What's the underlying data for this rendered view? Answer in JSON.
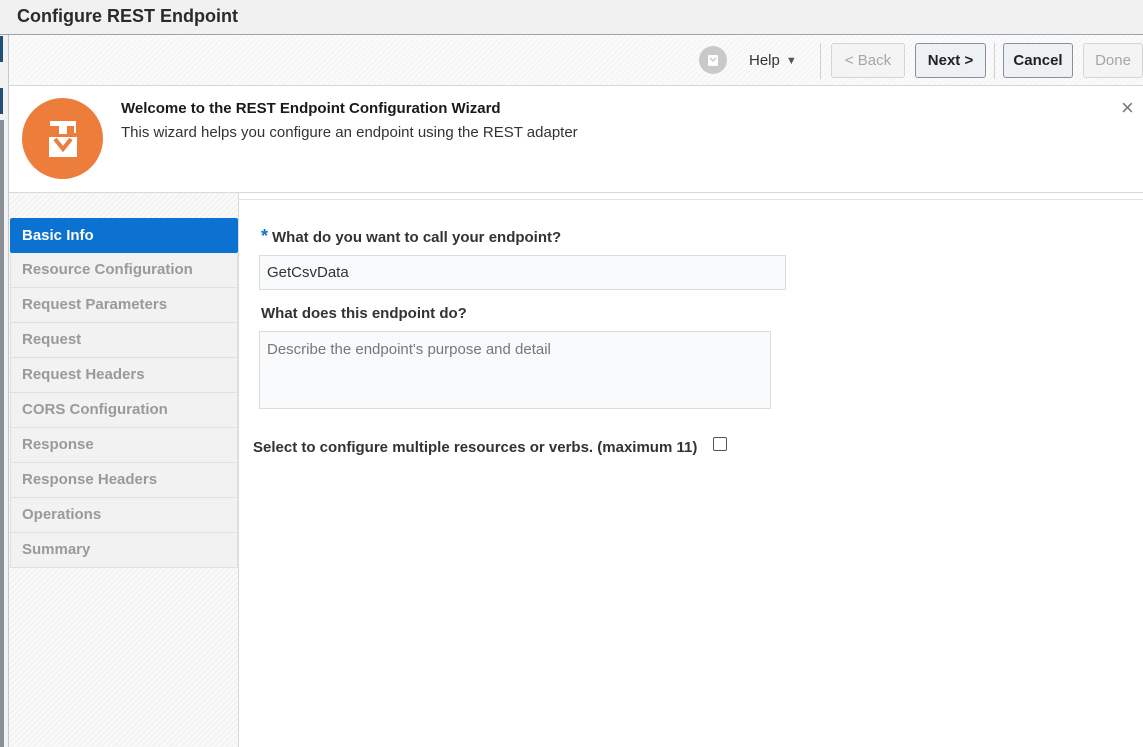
{
  "window": {
    "title": "Configure REST Endpoint"
  },
  "toolbar": {
    "help_label": "Help",
    "back_label": "< Back",
    "next_label": "Next >",
    "cancel_label": "Cancel",
    "done_label": "Done"
  },
  "welcome": {
    "title": "Welcome to the REST Endpoint Configuration Wizard",
    "subtitle": "This wizard helps you configure an endpoint using the REST adapter",
    "close_icon": "×"
  },
  "nav": {
    "items": [
      {
        "label": "Basic Info",
        "active": true
      },
      {
        "label": "Resource Configuration"
      },
      {
        "label": "Request Parameters"
      },
      {
        "label": "Request"
      },
      {
        "label": "Request Headers"
      },
      {
        "label": "CORS Configuration"
      },
      {
        "label": "Response"
      },
      {
        "label": "Response Headers"
      },
      {
        "label": "Operations"
      },
      {
        "label": "Summary"
      }
    ]
  },
  "form": {
    "required_marker": "*",
    "name_label": "What do you want to call your endpoint?",
    "name_value": "GetCsvData",
    "desc_label": "What does this endpoint do?",
    "desc_placeholder": "Describe the endpoint's purpose and detail",
    "multi_label": "Select to configure multiple resources or verbs. (maximum 11)",
    "multi_checked": false
  },
  "colors": {
    "accent": "#0b72d2",
    "logo": "#ed7d3a"
  }
}
